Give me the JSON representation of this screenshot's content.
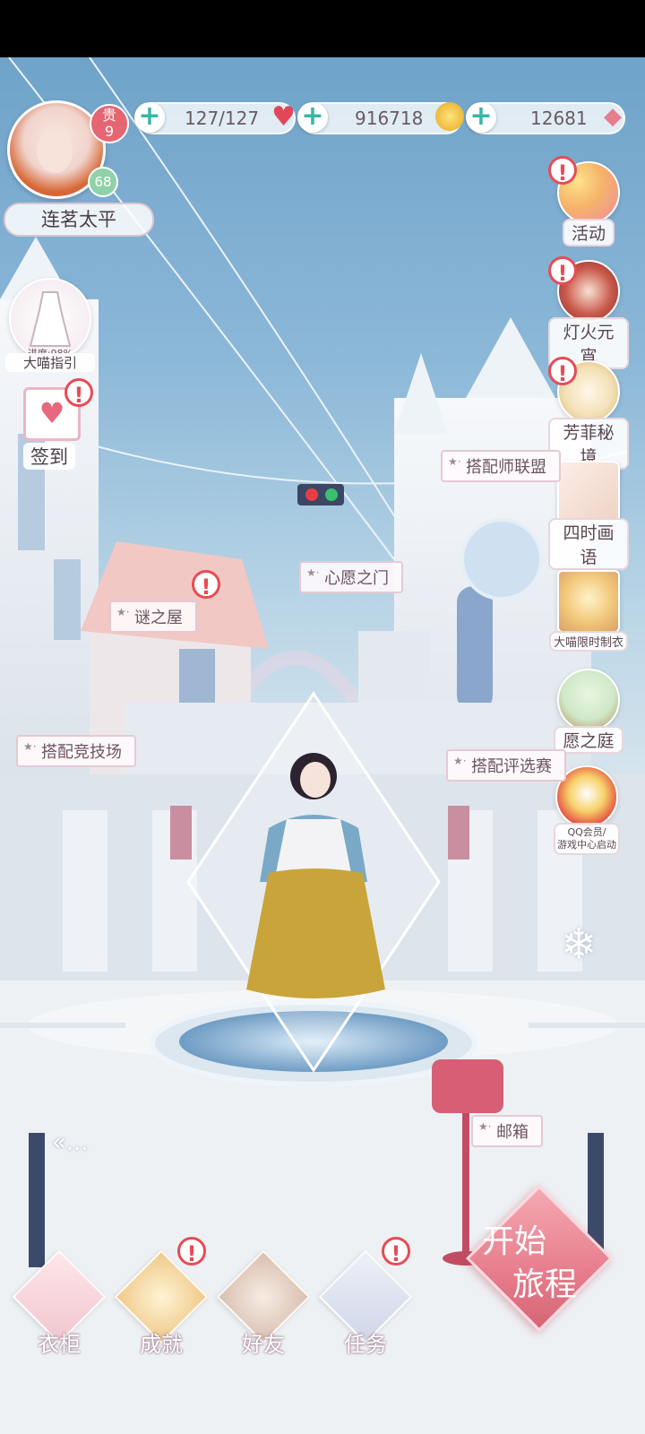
{
  "stats": {
    "stamina": "127/127",
    "coins": "916718",
    "diamonds": "12681"
  },
  "player": {
    "vip_label": "贵",
    "vip_level": "9",
    "level": "68",
    "name": "连茗太平"
  },
  "left_menu": {
    "guide_progress": "进度:98%",
    "guide_label": "大喵指引",
    "signin_label": "签到"
  },
  "right_menu": [
    {
      "label": "活动"
    },
    {
      "label": "灯火元宵"
    },
    {
      "label": "芳菲秘境"
    },
    {
      "label": "四时画语"
    },
    {
      "label": "大喵限时制衣"
    },
    {
      "label": "愿之庭"
    },
    {
      "label": "QQ会员/\n游戏中心启动"
    }
  ],
  "scene_signs": {
    "designer_alliance": "搭配师联盟",
    "wish_gate": "心愿之门",
    "mystery_house": "谜之屋",
    "arena": "搭配竞技场",
    "contest": "搭配评选赛",
    "mailbox": "邮箱",
    "more": "«..."
  },
  "start_button": {
    "line1": "开始",
    "line2": "旅程"
  },
  "bottom_nav": [
    {
      "label": "衣柜"
    },
    {
      "label": "成就"
    },
    {
      "label": "好友"
    },
    {
      "label": "任务"
    }
  ],
  "colors": {
    "accent_pink": "#e77d8c",
    "alert_red": "#e84b55",
    "plus_teal": "#36b7a8"
  }
}
